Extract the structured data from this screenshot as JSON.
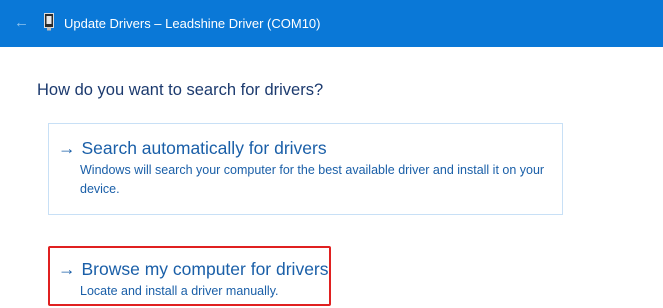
{
  "titlebar": {
    "back_icon": "back-arrow-icon",
    "device_icon": "usb-device-icon",
    "title": "Update Drivers – Leadshine Driver (COM10)"
  },
  "heading": "How do you want to search for drivers?",
  "options": [
    {
      "arrow": "→",
      "title": "Search automatically for drivers",
      "description": "Windows will search your computer for the best available driver and install it on your device."
    },
    {
      "arrow": "→",
      "title": "Browse my computer for drivers",
      "description": "Locate and install a driver manually."
    }
  ],
  "colors": {
    "titlebar": "#0a78d7",
    "link_text": "#1a5fa8",
    "highlight_border": "#e02020"
  }
}
